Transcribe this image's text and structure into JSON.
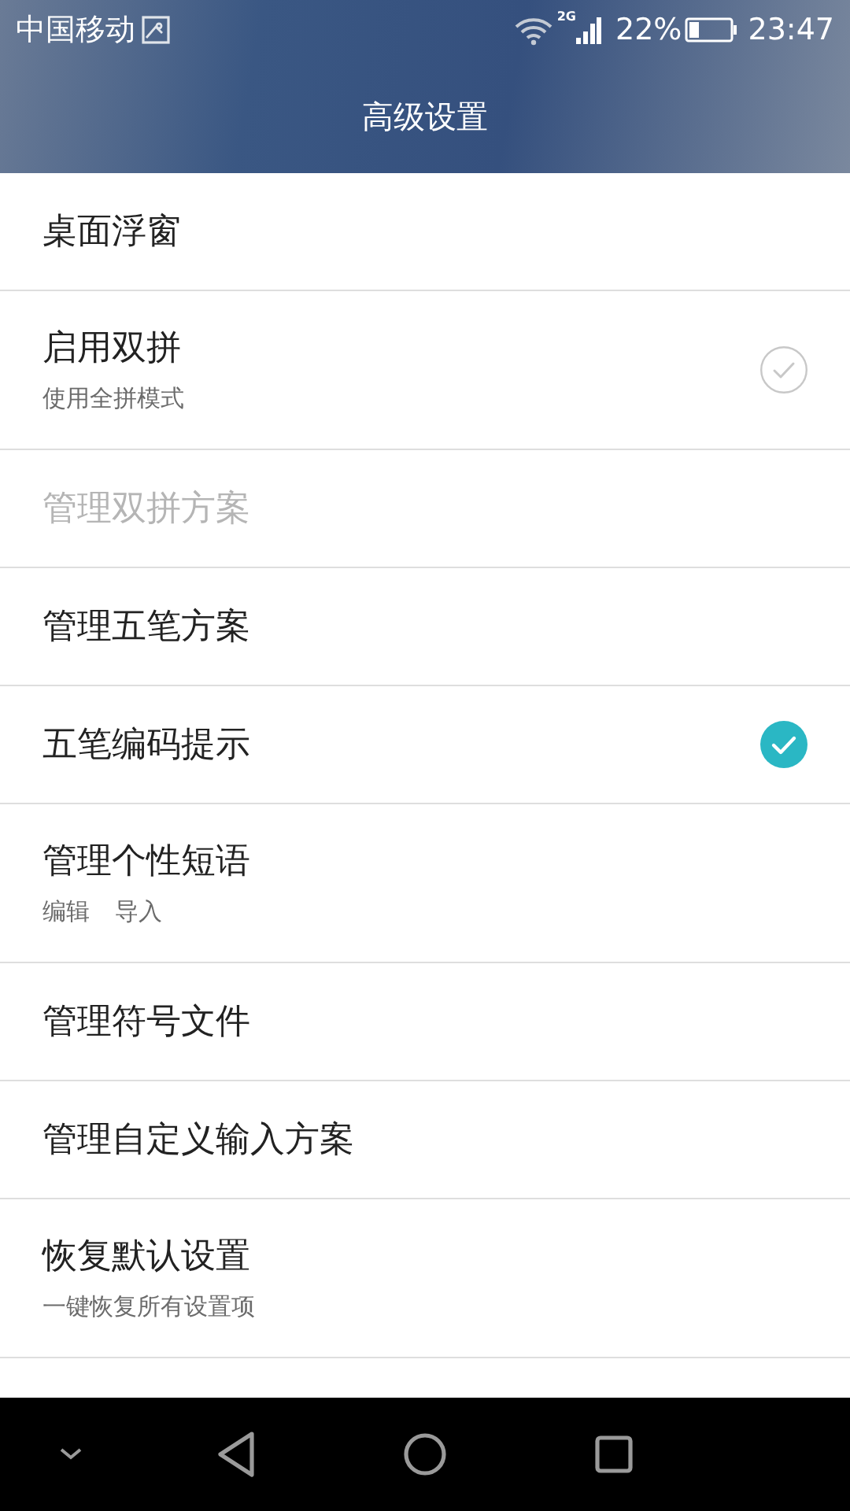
{
  "status_bar": {
    "carrier": "中国移动",
    "network": "2G",
    "battery": "22%",
    "time": "23:47"
  },
  "header": {
    "title": "高级设置"
  },
  "rows": [
    {
      "kind": "plain",
      "title": "桌面浮窗",
      "disabled": false
    },
    {
      "kind": "check",
      "title": "启用双拼",
      "subtitles": [
        "使用全拼模式"
      ],
      "checked": false,
      "disabled": false
    },
    {
      "kind": "plain",
      "title": "管理双拼方案",
      "disabled": true
    },
    {
      "kind": "plain",
      "title": "管理五笔方案",
      "disabled": false
    },
    {
      "kind": "check",
      "title": "五笔编码提示",
      "checked": true,
      "disabled": false
    },
    {
      "kind": "plain",
      "title": "管理个性短语",
      "subtitles": [
        "编辑",
        "导入"
      ],
      "disabled": false
    },
    {
      "kind": "plain",
      "title": "管理符号文件",
      "disabled": false
    },
    {
      "kind": "plain",
      "title": "管理自定义输入方案",
      "disabled": false
    },
    {
      "kind": "plain",
      "title": "恢复默认设置",
      "subtitles": [
        "一键恢复所有设置项"
      ],
      "disabled": false
    }
  ]
}
